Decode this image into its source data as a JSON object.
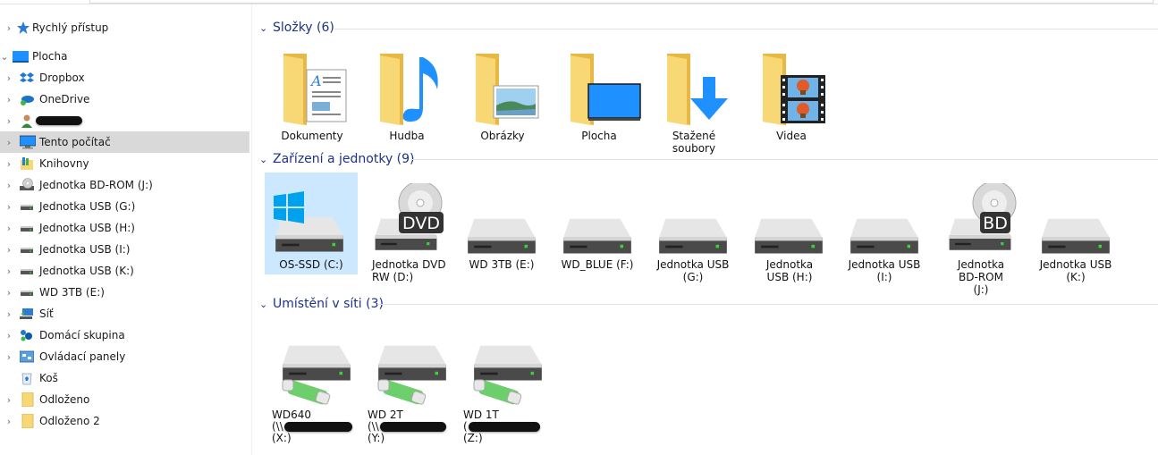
{
  "nav": {
    "items": [
      {
        "label": "Rychlý přístup",
        "icon": "star-icon",
        "expanded": false
      },
      {
        "label": "Plocha",
        "icon": "desktop-icon",
        "expanded": true
      },
      {
        "label": "Dropbox",
        "icon": "dropbox-icon"
      },
      {
        "label": "OneDrive",
        "icon": "onedrive-icon"
      },
      {
        "label": "",
        "icon": "user-icon",
        "redacted": true
      },
      {
        "label": "Tento počítač",
        "icon": "computer-icon",
        "selected": true
      },
      {
        "label": "Knihovny",
        "icon": "libraries-icon"
      },
      {
        "label": "Jednotka BD-ROM (J:)",
        "icon": "bd-drive-icon"
      },
      {
        "label": "Jednotka USB (G:)",
        "icon": "usb-drive-icon"
      },
      {
        "label": "Jednotka USB (H:)",
        "icon": "usb-drive-icon"
      },
      {
        "label": "Jednotka USB (I:)",
        "icon": "usb-drive-icon"
      },
      {
        "label": "Jednotka USB (K:)",
        "icon": "usb-drive-icon"
      },
      {
        "label": "WD 3TB (E:)",
        "icon": "hdd-icon"
      },
      {
        "label": "Síť",
        "icon": "network-icon"
      },
      {
        "label": "Domácí skupina",
        "icon": "homegroup-icon"
      },
      {
        "label": "Ovládací panely",
        "icon": "control-panel-icon"
      },
      {
        "label": "Koš",
        "icon": "recycle-bin-icon"
      },
      {
        "label": "Odloženo",
        "icon": "folder-icon"
      },
      {
        "label": "Odloženo 2",
        "icon": "folder-icon"
      }
    ]
  },
  "groups": {
    "folders": {
      "title": "Složky (6)",
      "items": [
        {
          "label": "Dokumenty",
          "icon": "documents-folder-icon"
        },
        {
          "label": "Hudba",
          "icon": "music-folder-icon"
        },
        {
          "label": "Obrázky",
          "icon": "pictures-folder-icon"
        },
        {
          "label": "Plocha",
          "icon": "desktop-folder-icon"
        },
        {
          "label": "Stažené soubory",
          "icon": "downloads-folder-icon"
        },
        {
          "label": "Videa",
          "icon": "videos-folder-icon"
        }
      ]
    },
    "devices": {
      "title": "Zařízení a jednotky (9)",
      "items": [
        {
          "label": "OS-SSD (C:)",
          "icon": "windows-drive-icon",
          "selected": true
        },
        {
          "label": "Jednotka DVD RW (D:)",
          "icon": "dvd-drive-icon",
          "badge": "DVD"
        },
        {
          "label": "WD 3TB (E:)",
          "icon": "hdd-icon"
        },
        {
          "label": "WD_BLUE (F:)",
          "icon": "hdd-icon"
        },
        {
          "label": "Jednotka USB (G:)",
          "icon": "hdd-icon"
        },
        {
          "label": "Jednotka USB (H:)",
          "icon": "hdd-icon"
        },
        {
          "label": "Jednotka USB (I:)",
          "icon": "hdd-icon"
        },
        {
          "label": "Jednotka BD-ROM (J:)",
          "icon": "bd-drive-icon",
          "badge": "BD"
        },
        {
          "label": "Jednotka USB (K:)",
          "icon": "hdd-icon"
        }
      ]
    },
    "network": {
      "title": "Umístění v síti (3)",
      "items": [
        {
          "name": "WD640",
          "path_prefix": "(\\\\",
          "drive": "(X:)",
          "icon": "network-drive-icon"
        },
        {
          "name": "WD 2T",
          "path_prefix": "(\\\\",
          "drive": "(Y:)",
          "icon": "network-drive-icon"
        },
        {
          "name": "WD 1T",
          "path_prefix": "(",
          "drive": "(Z:)",
          "icon": "network-drive-icon"
        }
      ]
    }
  },
  "colors": {
    "group_title": "#1e3287",
    "selection": "#cce8ff",
    "nav_selected": "#d9d9d9",
    "folder": "#f8d775",
    "accent_blue": "#1e90ff"
  }
}
